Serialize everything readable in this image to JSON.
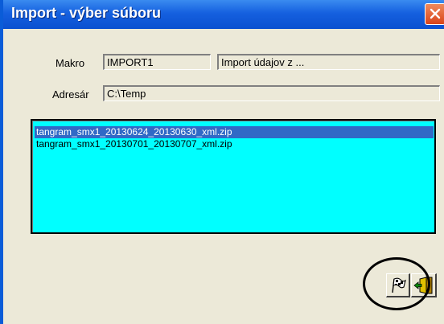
{
  "window": {
    "title": "Import - výber súboru",
    "close_icon": "close-icon"
  },
  "form": {
    "makro_label": "Makro",
    "makro_code": "IMPORT1",
    "makro_description": "Import údajov z ...",
    "adresar_label": "Adresár",
    "adresar_value": "C:\\Temp"
  },
  "files": [
    {
      "name": "tangram_smx1_20130624_20130630_xml.zip",
      "selected": true
    },
    {
      "name": "tangram_smx1_20130701_20130707_xml.zip",
      "selected": false
    }
  ],
  "toolbar": {
    "confirm_icon": "checkered-flag-icon",
    "exit_icon": "exit-door-icon"
  },
  "colors": {
    "titlebar": "#0a50d0",
    "list_background": "#00ffff",
    "selection": "#3169c6",
    "annotation": "#000000"
  }
}
